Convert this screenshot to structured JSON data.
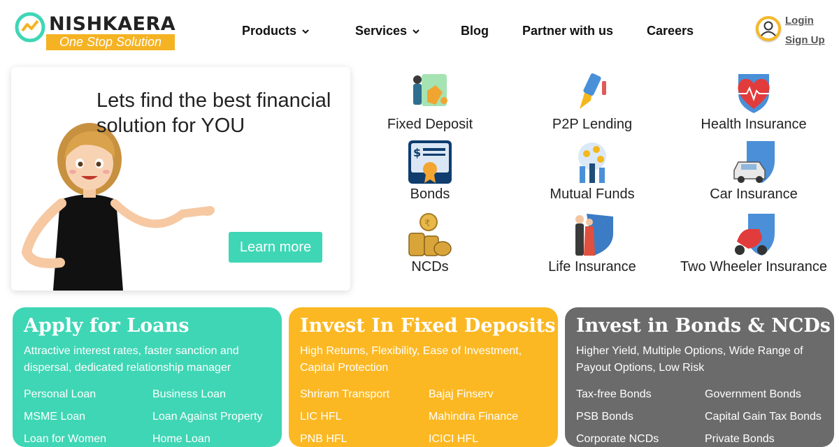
{
  "brand": {
    "name": "NISHKAERA",
    "tagline": "One Stop Solution",
    "colors": {
      "teal": "#3fd6b5",
      "amber": "#f5b323",
      "gray": "#6b6b6b"
    }
  },
  "nav": {
    "products": "Products",
    "services": "Services",
    "blog": "Blog",
    "partner": "Partner with us",
    "careers": "Careers",
    "login": "Login",
    "signup": "Sign Up"
  },
  "hero": {
    "title": "Lets find the best financial solution for YOU",
    "cta": "Learn more"
  },
  "products": [
    {
      "label": "Fixed Deposit",
      "icon": "fixed-deposit-icon"
    },
    {
      "label": "P2P Lending",
      "icon": "p2p-lending-icon"
    },
    {
      "label": "Health Insurance",
      "icon": "health-insurance-icon"
    },
    {
      "label": "Bonds",
      "icon": "bonds-icon"
    },
    {
      "label": "Mutual Funds",
      "icon": "mutual-funds-icon"
    },
    {
      "label": "Car Insurance",
      "icon": "car-insurance-icon"
    },
    {
      "label": "NCDs",
      "icon": "ncds-icon"
    },
    {
      "label": "Life Insurance",
      "icon": "life-insurance-icon"
    },
    {
      "label": "Two Wheeler Insurance",
      "icon": "two-wheeler-insurance-icon"
    }
  ],
  "cards": [
    {
      "title": "Apply for Loans",
      "desc": "Attractive interest rates, faster sanction and dispersal, dedicated relationship manager",
      "links": [
        "Personal Loan",
        "Business Loan",
        "MSME Loan",
        "Loan Against Property",
        "Loan for Women",
        "Home Loan"
      ]
    },
    {
      "title": "Invest In Fixed Deposits",
      "desc": "High Returns, Flexibility, Ease of Investment, Capital Protection",
      "links": [
        "Shriram Transport",
        "Bajaj Finserv",
        "LIC HFL",
        "Mahindra Finance",
        "PNB HFL",
        "ICICI HFL"
      ]
    },
    {
      "title": "Invest in Bonds & NCDs",
      "desc": "Higher Yield, Multiple Options, Wide Range of Payout Options, Low Risk",
      "links": [
        "Tax-free Bonds",
        "Government Bonds",
        "PSB Bonds",
        "Capital Gain Tax Bonds",
        "Corporate NCDs",
        "Private Bonds"
      ]
    }
  ]
}
